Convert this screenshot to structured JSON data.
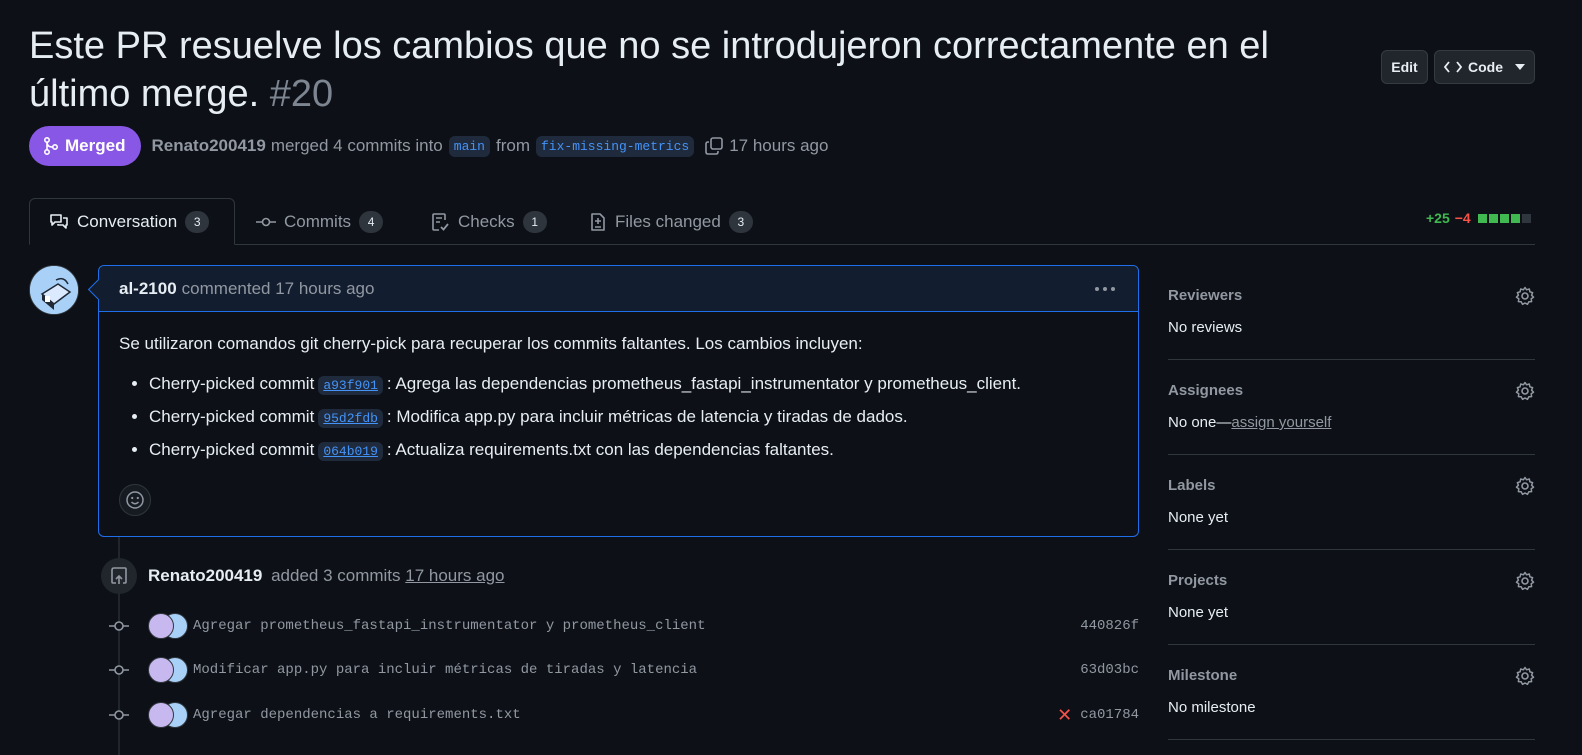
{
  "pr": {
    "title": "Este PR resuelve los cambios que no se introdujeron correctamente en el último merge.",
    "number": "#20",
    "edit_label": "Edit",
    "code_label": "Code",
    "state": "Merged",
    "author": "Renato200419",
    "merge_text": "merged 4 commits into",
    "base_branch": "main",
    "from_text": "from",
    "head_branch": "fix-missing-metrics",
    "time": "17 hours ago"
  },
  "tabs": [
    {
      "label": "Conversation",
      "count": "3"
    },
    {
      "label": "Commits",
      "count": "4"
    },
    {
      "label": "Checks",
      "count": "1"
    },
    {
      "label": "Files changed",
      "count": "3"
    }
  ],
  "diffstat": {
    "additions": "+25",
    "deletions": "−4",
    "colors": [
      "#3fb950",
      "#3fb950",
      "#3fb950",
      "#3fb950",
      "#30363d"
    ]
  },
  "comment": {
    "author": "al-2100",
    "meta": "commented 17 hours ago",
    "intro": "Se utilizaron comandos git cherry-pick para recuperar los commits faltantes. Los cambios incluyen:",
    "items": [
      {
        "prefix": "Cherry-picked commit",
        "sha": "a93f901",
        "text": ": Agrega las dependencias prometheus_fastapi_instrumentator y prometheus_client."
      },
      {
        "prefix": "Cherry-picked commit",
        "sha": "95d2fdb",
        "text": ": Modifica app.py para incluir métricas de latencia y tiradas de dados."
      },
      {
        "prefix": "Cherry-picked commit",
        "sha": "064b019",
        "text": ": Actualiza requirements.txt con las dependencias faltantes."
      }
    ]
  },
  "event": {
    "author": "Renato200419",
    "text": "added 3 commits",
    "time": "17 hours ago"
  },
  "commits": [
    {
      "message": "Agregar prometheus_fastapi_instrumentator y prometheus_client",
      "sha": "440826f",
      "failed": false
    },
    {
      "message": "Modificar app.py para incluir métricas de tiradas y latencia",
      "sha": "63d03bc",
      "failed": false
    },
    {
      "message": "Agregar dependencias a requirements.txt",
      "sha": "ca01784",
      "failed": true,
      "status_icon": "x-icon"
    }
  ],
  "sidebar": [
    {
      "title": "Reviewers",
      "value": "No reviews"
    },
    {
      "title": "Assignees",
      "value": "No one—",
      "link": "assign yourself"
    },
    {
      "title": "Labels",
      "value": "None yet"
    },
    {
      "title": "Projects",
      "value": "None yet"
    },
    {
      "title": "Milestone",
      "value": "No milestone"
    }
  ],
  "colors": {
    "merged": "#8957e5",
    "link": "#4493f8",
    "accent_border": "#1f6feb"
  }
}
